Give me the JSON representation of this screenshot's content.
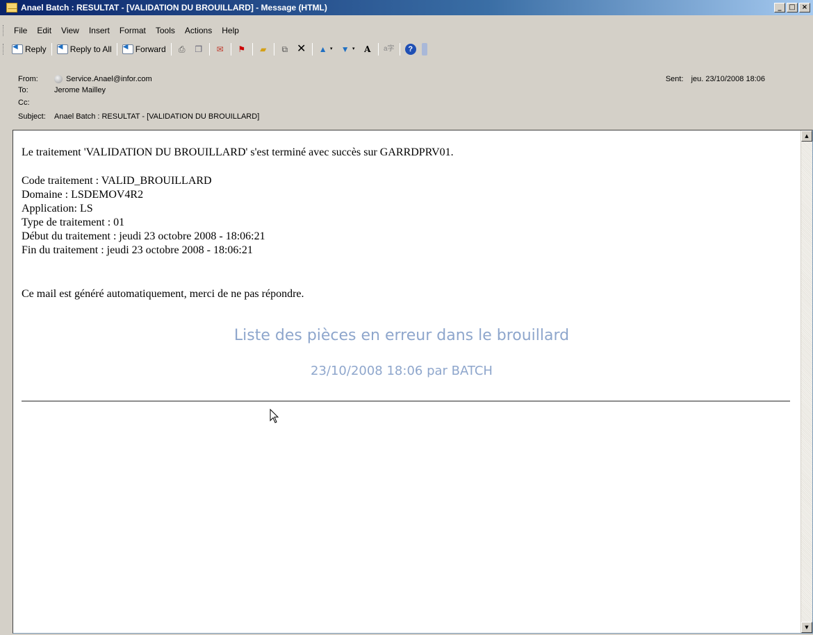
{
  "window": {
    "title": "Anael Batch : RESULTAT - [VALIDATION DU BROUILLARD] - Message (HTML)",
    "controls": {
      "minimize": "_",
      "maximize": "□",
      "close": "×"
    }
  },
  "menubar": {
    "items": [
      "File",
      "Edit",
      "View",
      "Insert",
      "Format",
      "Tools",
      "Actions",
      "Help"
    ]
  },
  "toolbar": {
    "reply_label": "Reply",
    "reply_all_label": "Reply to All",
    "forward_label": "Forward",
    "icons": [
      "print-icon",
      "copy-icon",
      "delete-flag-icon",
      "flag-icon",
      "move-icon",
      "tasks-icon",
      "delete-icon",
      "previous-icon",
      "next-icon",
      "font-size-icon",
      "translate-icon",
      "help-icon"
    ]
  },
  "header": {
    "from_label": "From:",
    "from_value": "Service.Anael@infor.com",
    "to_label": "To:",
    "to_value": "Jerome Mailley",
    "cc_label": "Cc:",
    "cc_value": "",
    "subject_label": "Subject:",
    "subject_value": "Anael Batch : RESULTAT - [VALIDATION DU BROUILLARD]",
    "sent_label": "Sent:",
    "sent_value": "jeu. 23/10/2008 18:06"
  },
  "body": {
    "intro": "Le traitement 'VALIDATION DU BROUILLARD' s'est terminé avec succès sur GARRDPRV01.",
    "details": [
      "Code traitement : VALID_BROUILLARD",
      "Domaine : LSDEMOV4R2",
      "Application: LS",
      "Type de traitement : 01",
      "Début du traitement : jeudi 23 octobre 2008 - 18:06:21",
      "Fin du traitement : jeudi 23 octobre 2008 - 18:06:21"
    ],
    "notice": "Ce mail est généré automatiquement, merci de ne pas répondre.",
    "report_title": "Liste des pièces en erreur dans le brouillard",
    "report_subtitle": "23/10/2008 18:06 par BATCH"
  },
  "colors": {
    "title_bar": "#0a246a",
    "report_text": "#8ea6cc",
    "chrome": "#d4d0c8"
  }
}
